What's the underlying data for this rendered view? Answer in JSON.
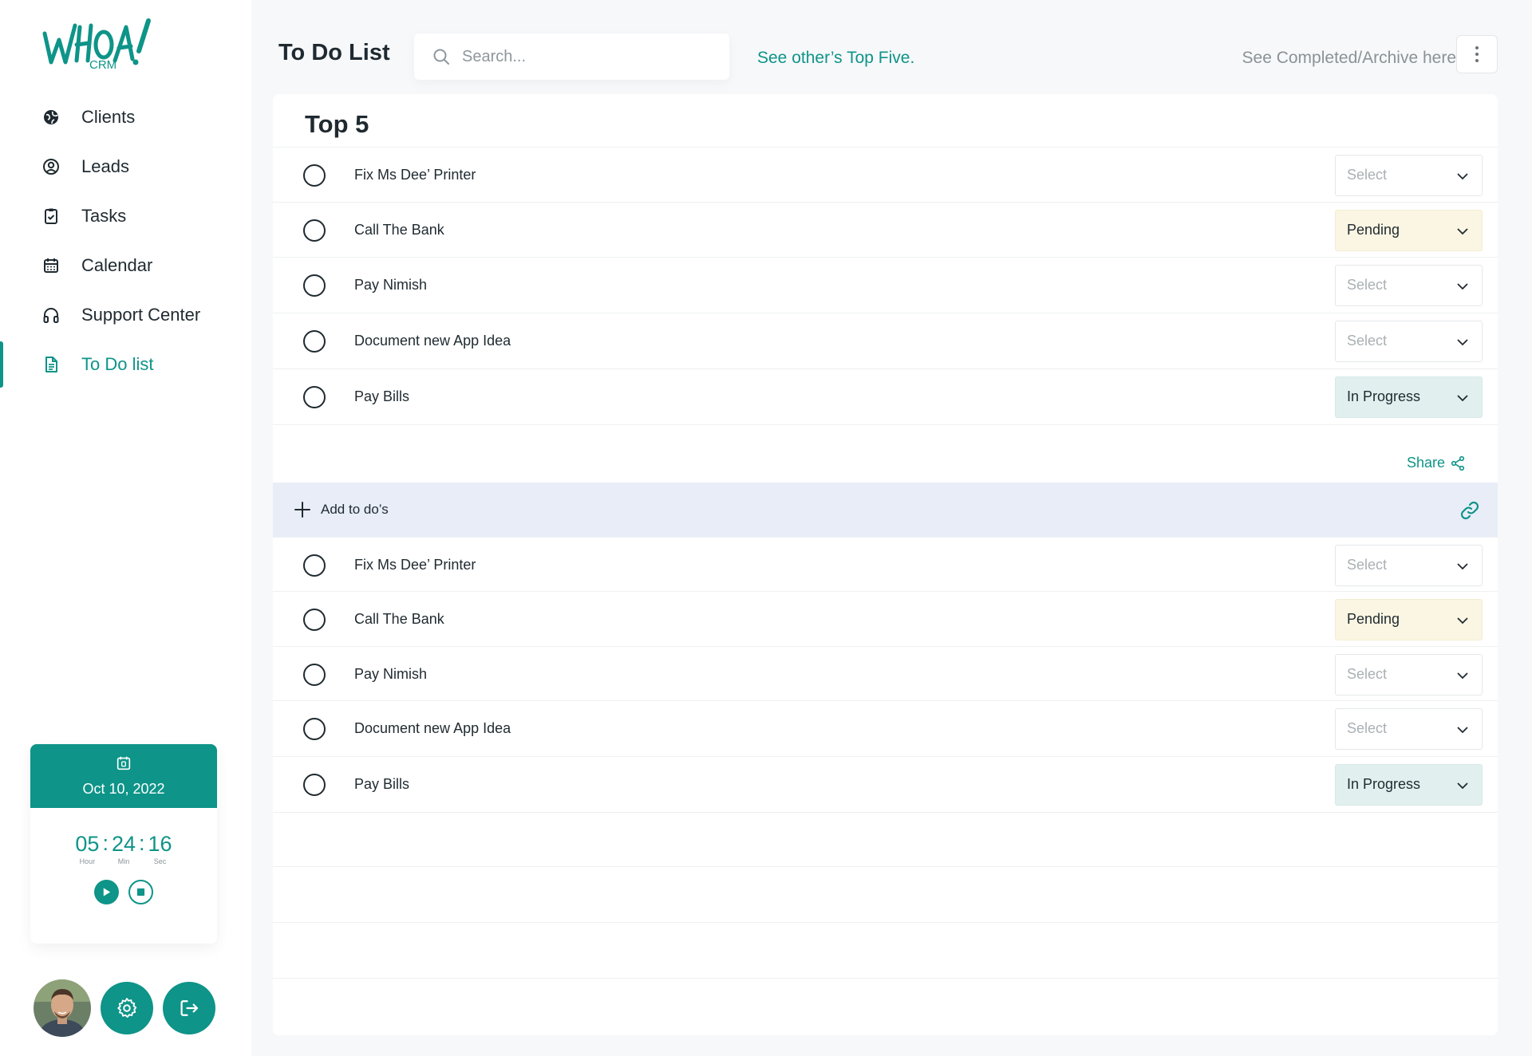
{
  "app": {
    "logo_text": "WHOA!",
    "logo_sub": "CRM"
  },
  "sidebar": {
    "items": [
      {
        "label": "Clients",
        "icon": "globe-icon"
      },
      {
        "label": "Leads",
        "icon": "user-circle-icon"
      },
      {
        "label": "Tasks",
        "icon": "clipboard-icon"
      },
      {
        "label": "Calendar",
        "icon": "calendar-icon"
      },
      {
        "label": "Support Center",
        "icon": "headphones-icon"
      },
      {
        "label": "To Do list",
        "icon": "document-icon",
        "active": true
      }
    ]
  },
  "timer": {
    "date": "Oct 10, 2022",
    "hours": "05",
    "minutes": "24",
    "seconds": "16",
    "hour_label": "Hour",
    "min_label": "Min",
    "sec_label": "Sec"
  },
  "header": {
    "title": "To Do List",
    "search_placeholder": "Search...",
    "top_five_link": "See other’s Top Five.",
    "archive_link": "See Completed/Archive here"
  },
  "top5": {
    "title": "Top 5",
    "rows": [
      {
        "task": "Fix Ms Dee’ Printer",
        "status": "Select"
      },
      {
        "task": "Call The Bank",
        "status": "Pending"
      },
      {
        "task": "Pay Nimish",
        "status": "Select"
      },
      {
        "task": "Document new App Idea",
        "status": "Select"
      },
      {
        "task": "Pay Bills",
        "status": "In Progress"
      }
    ]
  },
  "share_label": "Share",
  "add_label": "Add to do’s",
  "todos": {
    "rows": [
      {
        "task": "Fix Ms Dee’ Printer",
        "status": "Select"
      },
      {
        "task": "Call The Bank",
        "status": "Pending"
      },
      {
        "task": "Pay Nimish",
        "status": "Select"
      },
      {
        "task": "Document new App Idea",
        "status": "Select"
      },
      {
        "task": "Pay Bills",
        "status": "In Progress"
      }
    ]
  },
  "colors": {
    "accent": "#0e9488",
    "pending_bg": "#fbf6e3",
    "in_progress_bg": "#e1f0ef",
    "add_bar_bg": "#e8edf7"
  }
}
